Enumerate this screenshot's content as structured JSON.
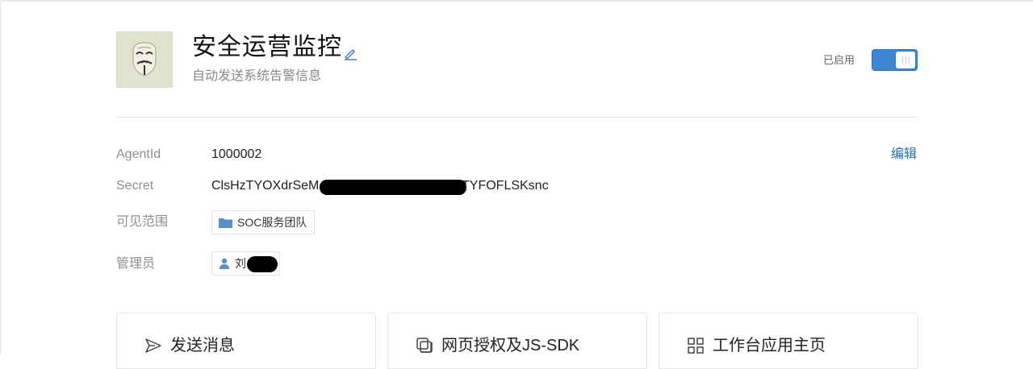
{
  "app": {
    "name": "安全运营监控",
    "description": "自动发送系统告警信息"
  },
  "status": {
    "label": "已启用",
    "enabled": true,
    "accent_color": "#3d86d4"
  },
  "details": {
    "edit_label": "编辑",
    "agent_id": {
      "label": "AgentId",
      "value": "1000002"
    },
    "secret": {
      "label": "Secret",
      "prefix": "ClsHzTYOXdrSeM",
      "suffix": "TYFOFLSKsnc"
    },
    "visibility": {
      "label": "可见范围",
      "tag": "SOC服务团队",
      "icon": "folder-icon"
    },
    "admin": {
      "label": "管理员",
      "name": "刘",
      "icon": "user-icon"
    }
  },
  "cards": [
    {
      "title": "发送消息",
      "icon": "send-icon"
    },
    {
      "title": "网页授权及JS-SDK",
      "icon": "copy-icon"
    },
    {
      "title": "工作台应用主页",
      "icon": "grid-icon"
    }
  ]
}
